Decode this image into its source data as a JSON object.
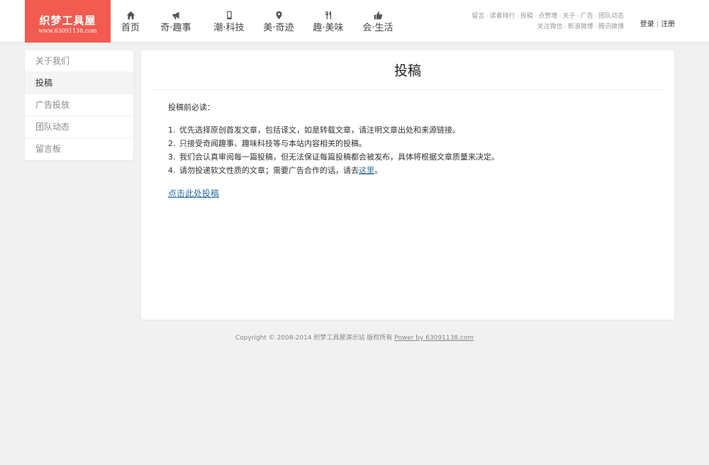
{
  "header": {
    "logo": {
      "title": "织梦工具屋",
      "url": "www.63091138.com"
    },
    "nav": [
      {
        "label": "首页",
        "icon": "home-icon"
      },
      {
        "label": "奇·趣事",
        "icon": "megaphone-icon"
      },
      {
        "label": "潮·科技",
        "icon": "phone-icon"
      },
      {
        "label": "美·奇迹",
        "icon": "map-pin-icon"
      },
      {
        "label": "趣·美味",
        "icon": "utensils-icon"
      },
      {
        "label": "会·生活",
        "icon": "thumbs-up-icon"
      }
    ],
    "toplinks_row1": [
      "留言",
      "读者排行",
      "投稿",
      "点赞墙",
      "关于",
      "广告",
      "团队动态"
    ],
    "toplinks_row2": [
      "关注微信",
      "新浪微博",
      "腾讯微博"
    ],
    "login": "登录",
    "register": "注册"
  },
  "sidebar": {
    "items": [
      {
        "label": "关于我们",
        "active": false
      },
      {
        "label": "投稿",
        "active": true
      },
      {
        "label": "广告投放",
        "active": false
      },
      {
        "label": "团队动态",
        "active": false
      },
      {
        "label": "留言板",
        "active": false
      }
    ]
  },
  "main": {
    "title": "投稿",
    "notice": "投稿前必读：",
    "rules": [
      {
        "num": "1.",
        "text": "优先选择原创首发文章，包括译文，如是转载文章，请注明文章出处和来源链接。"
      },
      {
        "num": "2.",
        "text": "只接受奇闻趣事、趣味科技等与本站内容相关的投稿。"
      },
      {
        "num": "3.",
        "text": "我们会认真审阅每一篇投稿，但无法保证每篇投稿都会被发布，具体将根据文章质量来决定。"
      },
      {
        "num": "4.",
        "text": "请勿投递软文性质的文章；需要广告合作的话，请去",
        "link": "这里",
        "suffix": "。"
      }
    ],
    "submit_link": "点击此处投稿"
  },
  "footer": {
    "text": "Copyright © 2008-2014 织梦工具屋演示站 版权所有",
    "link": "Power by 63091138.com"
  },
  "colors": {
    "brand": "#f25b4f",
    "link": "#2c6fa3",
    "background": "#f1f1f1"
  }
}
